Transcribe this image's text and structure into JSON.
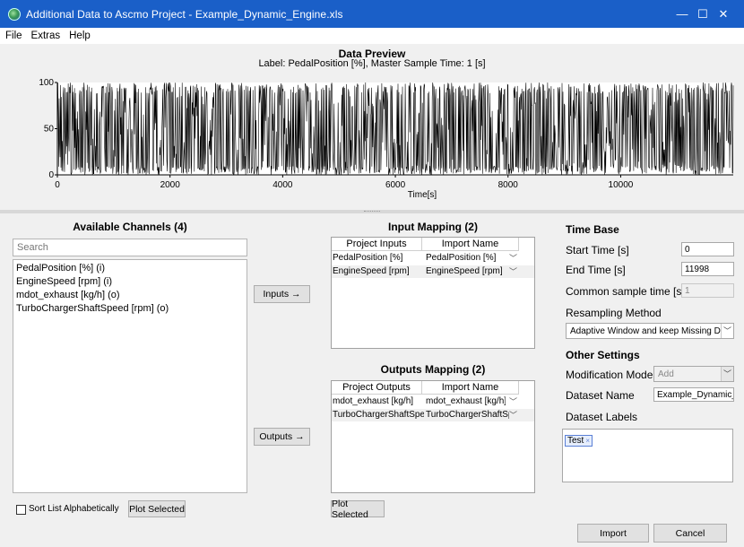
{
  "window": {
    "title": "Additional Data to Ascmo Project - Example_Dynamic_Engine.xls",
    "minimize_glyph": "—",
    "maximize_glyph": "☐",
    "close_glyph": "✕"
  },
  "menu": [
    "File",
    "Extras",
    "Help"
  ],
  "preview": {
    "title": "Data Preview",
    "subtitle": "Label: PedalPosition [%], Master Sample Time: 1 [s]"
  },
  "chart_data": {
    "type": "line",
    "title": "Data Preview",
    "subtitle": "Label: PedalPosition [%], Master Sample Time: 1 [s]",
    "xlabel": "Time[s]",
    "ylabel": "",
    "xlim": [
      0,
      11998
    ],
    "ylim": [
      0,
      100
    ],
    "x_ticks": [
      0,
      2000,
      4000,
      6000,
      8000,
      10000
    ],
    "y_ticks": [
      0,
      50,
      100
    ],
    "grid": false,
    "series": [
      {
        "color": "#000000",
        "sample_time": 1,
        "range": [
          0,
          100
        ],
        "note_x_start": 0,
        "note_x_end": 11998
      }
    ]
  },
  "available": {
    "title": "Available Channels (4)",
    "search_placeholder": "Search",
    "items": [
      "PedalPosition  [%] (i)",
      "EngineSpeed  [rpm] (i)",
      "mdot_exhaust  [kg/h] (o)",
      "TurboChargerShaftSpeed  [rpm] (o)"
    ],
    "sort_label": "Sort List Alphabetically",
    "plot_button": "Plot Selected"
  },
  "buttons": {
    "inputs": "Inputs →",
    "outputs": "Outputs →",
    "plot_selected_mapping": "Plot Selected",
    "import": "Import",
    "cancel": "Cancel"
  },
  "input_mapping": {
    "title": "Input Mapping (2)",
    "columns": [
      "Project Inputs",
      "Import Name"
    ],
    "rows": [
      {
        "project": "PedalPosition [%]",
        "import": "PedalPosition  [%]"
      },
      {
        "project": "EngineSpeed [rpm]",
        "import": "EngineSpeed  [rpm]"
      }
    ]
  },
  "output_mapping": {
    "title": "Outputs Mapping (2)",
    "columns": [
      "Project Outputs",
      "Import Name"
    ],
    "rows": [
      {
        "project": "mdot_exhaust [kg/h]",
        "import": "mdot_exhaust  [kg/h]"
      },
      {
        "project": "TurboChargerShaftSpee...",
        "import": "TurboChargerShaftSpee"
      }
    ]
  },
  "time_base": {
    "title": "Time Base",
    "start_label": "Start Time [s]",
    "start_value": "0",
    "end_label": "End Time [s]",
    "end_value": "11998",
    "sample_label": "Common sample time [s]",
    "sample_value": "1",
    "resampling_label": "Resampling Method",
    "resampling_value": "Adaptive Window and keep Missing Data"
  },
  "other": {
    "title": "Other Settings",
    "mode_label": "Modification Mode",
    "mode_value": "Add",
    "name_label": "Dataset Name",
    "name_value": "Example_Dynamic_Er",
    "labels_label": "Dataset Labels",
    "tags": [
      {
        "text": "Test",
        "remove": "×"
      }
    ]
  },
  "colors": {
    "titlebar": "#1a5fc8",
    "tag_border": "#5a7fd6"
  }
}
